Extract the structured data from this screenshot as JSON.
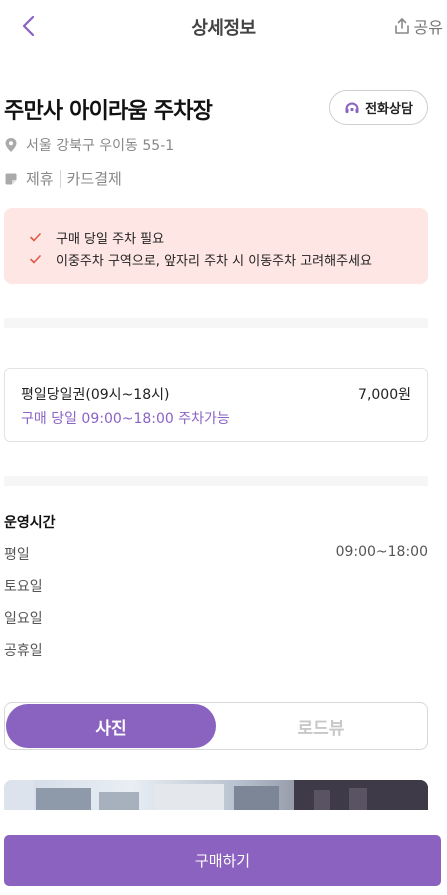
{
  "header": {
    "title": "상세정보",
    "share_label": "공유"
  },
  "lot": {
    "name": "주만사 아이라움 주차장",
    "call_label": "전화상담",
    "address": "서울 강북구 우이동 55-1",
    "tags": [
      "제휴",
      "카드결제"
    ]
  },
  "notices": [
    "구매 당일 주차 필요",
    "이중주차 구역으로, 앞자리 주차 시 이동주차 고려해주세요"
  ],
  "ticket": {
    "name": "평일당일권(09시~18시)",
    "price": "7,000원",
    "desc": "구매 당일 09:00~18:00 주차가능"
  },
  "hours": {
    "title": "운영시간",
    "rows": [
      {
        "day": "평일",
        "time": "09:00~18:00"
      },
      {
        "day": "토요일",
        "time": ""
      },
      {
        "day": "일요일",
        "time": ""
      },
      {
        "day": "공휴일",
        "time": ""
      }
    ]
  },
  "view_tabs": {
    "photo": "사진",
    "roadview": "로드뷰",
    "selected": "사진"
  },
  "buy_label": "구매하기",
  "colors": {
    "accent": "#8a62c0",
    "notice_bg": "#fde6e3",
    "check": "#e05a4a"
  }
}
